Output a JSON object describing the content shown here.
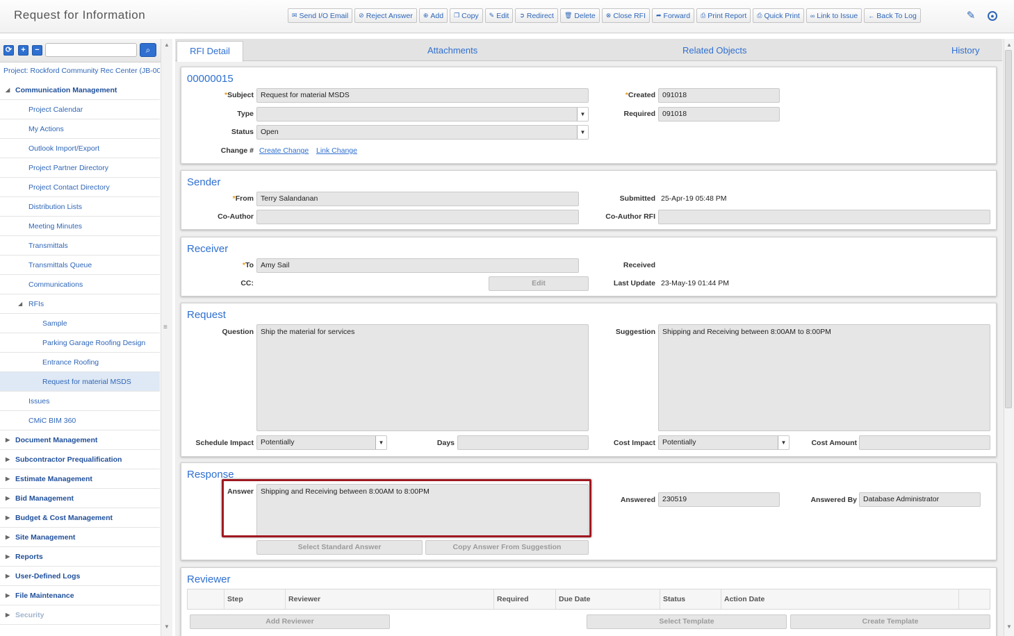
{
  "header": {
    "title": "Request for Information",
    "toolbar": [
      {
        "icon": "envelope-icon",
        "glyph": "✉",
        "label": "Send I/O Email"
      },
      {
        "icon": "reject-icon",
        "glyph": "⊘",
        "label": "Reject Answer"
      },
      {
        "icon": "add-icon",
        "glyph": "⊕",
        "label": "Add"
      },
      {
        "icon": "copy-icon",
        "glyph": "❐",
        "label": "Copy"
      },
      {
        "icon": "edit-icon",
        "glyph": "✎",
        "label": "Edit"
      },
      {
        "icon": "redirect-icon",
        "glyph": "➲",
        "label": "Redirect"
      },
      {
        "icon": "trash-icon",
        "glyph": "🗑",
        "label": "Delete"
      },
      {
        "icon": "close-rfi-icon",
        "glyph": "⊗",
        "label": "Close RFI"
      },
      {
        "icon": "forward-icon",
        "glyph": "➦",
        "label": "Forward"
      },
      {
        "icon": "print-icon",
        "glyph": "⎙",
        "label": "Print Report"
      },
      {
        "icon": "quick-print-icon",
        "glyph": "⎙",
        "label": "Quick Print"
      },
      {
        "icon": "link-icon",
        "glyph": "∞",
        "label": "Link to Issue"
      },
      {
        "icon": "back-arrow-icon",
        "glyph": "←",
        "label": "Back To Log"
      }
    ]
  },
  "sidebar": {
    "project": "Project: Rockford Community Rec Center (JB-000",
    "items": [
      {
        "label": "Communication Management",
        "level": 0,
        "expanded": true,
        "top": true
      },
      {
        "label": "Project Calendar",
        "level": 1
      },
      {
        "label": "My Actions",
        "level": 1
      },
      {
        "label": "Outlook Import/Export",
        "level": 1
      },
      {
        "label": "Project Partner Directory",
        "level": 1
      },
      {
        "label": "Project Contact Directory",
        "level": 1
      },
      {
        "label": "Distribution Lists",
        "level": 1
      },
      {
        "label": "Meeting Minutes",
        "level": 1
      },
      {
        "label": "Transmittals",
        "level": 1
      },
      {
        "label": "Transmittals Queue",
        "level": 1
      },
      {
        "label": "Communications",
        "level": 1
      },
      {
        "label": "RFIs",
        "level": 1,
        "expanded": true
      },
      {
        "label": "Sample",
        "level": 2
      },
      {
        "label": "Parking Garage Roofing Design",
        "level": 2
      },
      {
        "label": "Entrance Roofing",
        "level": 2
      },
      {
        "label": "Request for material MSDS",
        "level": 2,
        "selected": true
      },
      {
        "label": "Issues",
        "level": 1
      },
      {
        "label": "CMiC BIM 360",
        "level": 1
      },
      {
        "label": "Document Management",
        "level": 0,
        "top": true
      },
      {
        "label": "Subcontractor Prequalification",
        "level": 0,
        "top": true
      },
      {
        "label": "Estimate Management",
        "level": 0,
        "top": true
      },
      {
        "label": "Bid Management",
        "level": 0,
        "top": true
      },
      {
        "label": "Budget & Cost Management",
        "level": 0,
        "top": true
      },
      {
        "label": "Site Management",
        "level": 0,
        "top": true
      },
      {
        "label": "Reports",
        "level": 0,
        "top": true
      },
      {
        "label": "User-Defined Logs",
        "level": 0,
        "top": true
      },
      {
        "label": "File Maintenance",
        "level": 0,
        "top": true
      },
      {
        "label": "Security",
        "level": 0,
        "top": true
      }
    ]
  },
  "tabs": [
    "RFI Detail",
    "Attachments",
    "Related Objects",
    "History"
  ],
  "rfi": {
    "number": "00000015",
    "subject_label": "Subject",
    "subject": "Request for material MSDS",
    "type_label": "Type",
    "type": "",
    "status_label": "Status",
    "status": "Open",
    "change_label": "Change #",
    "create_change": "Create Change",
    "link_change": "Link Change",
    "created_label": "Created",
    "created": "091018",
    "required_label": "Required",
    "required": "091018"
  },
  "sender": {
    "title": "Sender",
    "from_label": "From",
    "from": "Terry Salandanan",
    "coauthor_label": "Co-Author",
    "coauthor": "",
    "submitted_label": "Submitted",
    "submitted": "25-Apr-19 05:48 PM",
    "coauthor_rfi_label": "Co-Author RFI",
    "coauthor_rfi": ""
  },
  "receiver": {
    "title": "Receiver",
    "to_label": "To",
    "to": "Amy Sail",
    "cc_label": "CC:",
    "edit": "Edit",
    "received_label": "Received",
    "received": "",
    "last_update_label": "Last Update",
    "last_update": "23-May-19 01:44 PM"
  },
  "request": {
    "title": "Request",
    "question_label": "Question",
    "question": "Ship the material for services",
    "suggestion_label": "Suggestion",
    "suggestion": "Shipping and Receiving between 8:00AM to 8:00PM",
    "schedule_impact_label": "Schedule Impact",
    "schedule_impact": "Potentially",
    "days_label": "Days",
    "days": "",
    "cost_impact_label": "Cost Impact",
    "cost_impact": "Potentially",
    "cost_amount_label": "Cost Amount",
    "cost_amount": ""
  },
  "response": {
    "title": "Response",
    "answer_label": "Answer",
    "answer": "Shipping and Receiving between 8:00AM to 8:00PM",
    "answered_label": "Answered",
    "answered": "230519",
    "answered_by_label": "Answered By",
    "answered_by": "Database Administrator",
    "select_standard": "Select Standard Answer",
    "copy_from_suggestion": "Copy Answer From Suggestion"
  },
  "reviewer": {
    "title": "Reviewer",
    "columns": [
      "Step",
      "Reviewer",
      "Required",
      "Due Date",
      "Status",
      "Action Date"
    ],
    "add_reviewer": "Add Reviewer",
    "select_template": "Select Template",
    "create_template": "Create Template"
  }
}
